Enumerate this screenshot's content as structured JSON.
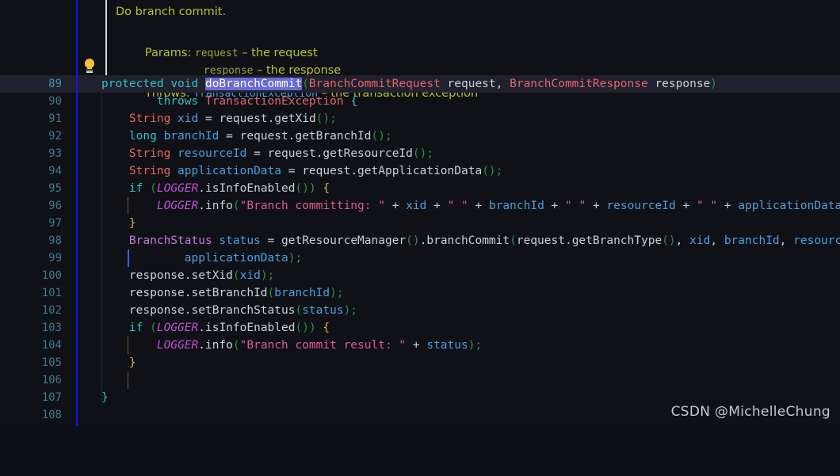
{
  "editor": {
    "theme_background": "#0f1117",
    "current_line_background": "#20202e",
    "gutter_rule_color": "#1616e8",
    "selection_color": "#6a6ad6"
  },
  "doc_popup": {
    "summary": "Do branch commit.",
    "params_label": "Params:",
    "params": [
      {
        "name": "request",
        "dash": "–",
        "desc": "the request"
      },
      {
        "name": "response",
        "dash": "–",
        "desc": "the response"
      }
    ],
    "throws_label": "Throws:",
    "throws": {
      "type": "TransactionException",
      "dash": "–",
      "desc": "the transaction exception"
    },
    "intention_icon": "lightbulb-icon"
  },
  "code": {
    "language": "Java",
    "selected_token": "doBranchCommit",
    "current_line": 89,
    "lines": [
      {
        "n": "89",
        "text": "    protected void doBranchCommit(BranchCommitRequest request, BranchCommitResponse response)"
      },
      {
        "n": "90",
        "text": "            throws TransactionException {"
      },
      {
        "n": "91",
        "text": "        String xid = request.getXid();"
      },
      {
        "n": "92",
        "text": "        long branchId = request.getBranchId();"
      },
      {
        "n": "93",
        "text": "        String resourceId = request.getResourceId();"
      },
      {
        "n": "94",
        "text": "        String applicationData = request.getApplicationData();"
      },
      {
        "n": "95",
        "text": "        if (LOGGER.isInfoEnabled()) {"
      },
      {
        "n": "96",
        "text": "            LOGGER.info(\"Branch committing: \" + xid + \" \" + branchId + \" \" + resourceId + \" \" + applicationData);"
      },
      {
        "n": "97",
        "text": "        }"
      },
      {
        "n": "98",
        "text": "        BranchStatus status = getResourceManager().branchCommit(request.getBranchType(), xid, branchId, resourceId,"
      },
      {
        "n": "99",
        "text": "                applicationData);"
      },
      {
        "n": "100",
        "text": "        response.setXid(xid);"
      },
      {
        "n": "101",
        "text": "        response.setBranchId(branchId);"
      },
      {
        "n": "102",
        "text": "        response.setBranchStatus(status);"
      },
      {
        "n": "103",
        "text": "        if (LOGGER.isInfoEnabled()) {"
      },
      {
        "n": "104",
        "text": "            LOGGER.info(\"Branch commit result: \" + status);"
      },
      {
        "n": "105",
        "text": "        }"
      },
      {
        "n": "106",
        "text": ""
      },
      {
        "n": "107",
        "text": "    }"
      },
      {
        "n": "108",
        "text": ""
      }
    ]
  },
  "watermark": {
    "text": "CSDN @MichelleChung"
  }
}
